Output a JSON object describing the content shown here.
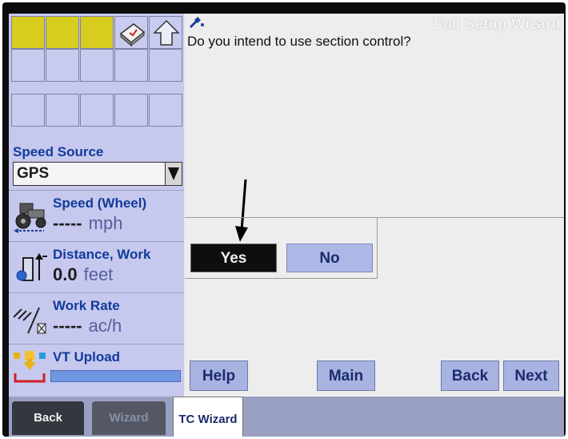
{
  "window": {
    "title": "Full Setup Wizard"
  },
  "question": "Do you intend to use section control?",
  "answers": {
    "yes": "Yes",
    "no": "No"
  },
  "footer": {
    "help": "Help",
    "main": "Main",
    "back": "Back",
    "next": "Next"
  },
  "left": {
    "speed_source_label": "Speed Source",
    "speed_source_value": "GPS",
    "readouts": [
      {
        "title": "Speed (Wheel)",
        "value": "-----",
        "unit": "mph",
        "icon": "tractor-speed-icon"
      },
      {
        "title": "Distance, Work",
        "value": "0.0",
        "unit": "feet",
        "icon": "distance-work-icon"
      },
      {
        "title": "Work Rate",
        "value": "-----",
        "unit": "ac/h",
        "icon": "work-rate-icon"
      },
      {
        "title": "VT Upload",
        "icon": "vt-upload-icon"
      }
    ],
    "upload_progress": 1.0
  },
  "tabs": {
    "back": "Back",
    "wizard": "Wizard",
    "tc_wizard": "TC Wizard"
  },
  "colors": {
    "accent_blue": "#123b9a",
    "button_blue": "#aeb8e6",
    "panel_lavender": "#c6c8ee",
    "grid_yellow": "#d8cc1e"
  }
}
